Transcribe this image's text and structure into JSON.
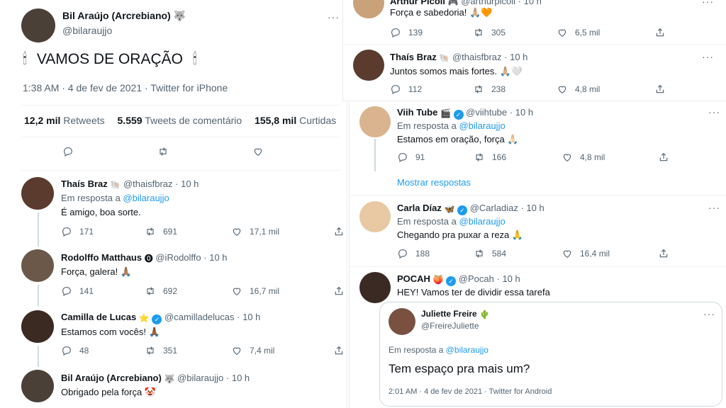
{
  "main_tweet": {
    "name": "Bil Araújo (Arcrebiano)",
    "name_emoji": "🐺",
    "handle": "@bilaraujjo",
    "text": "VAMOS DE ORAÇÃO",
    "lead_emoji": "🕯",
    "trail_emoji": "🕯",
    "timestamp": "1:38 AM · 4 de fev de 2021 · Twitter for iPhone",
    "retweets_count": "12,2 mil",
    "retweets_label": "Retweets",
    "quotes_count": "5.559",
    "quotes_label": "Tweets de comentário",
    "likes_count": "155,8 mil",
    "likes_label": "Curtidas"
  },
  "left_replies": [
    {
      "name": "Thaís Braz",
      "badge": "🐚",
      "handle": "@thaisfbraz",
      "time": "10 h",
      "reply_prefix": "Em resposta a",
      "reply_to": "@bilaraujjo",
      "text": "É amigo, boa sorte.",
      "replies": "171",
      "retweets": "691",
      "likes": "17,1 mil",
      "avatar_color": "#5a3b2e"
    },
    {
      "name": "Rodolffo Matthaus",
      "badge": "⓿",
      "handle": "@iRodolffo",
      "time": "10 h",
      "text": "Força, galera! 🙏🏽",
      "replies": "141",
      "retweets": "692",
      "likes": "16,7 mil",
      "avatar_color": "#6b5848"
    },
    {
      "name": "Camilla de Lucas",
      "badge": "⭐",
      "verified": "✓",
      "handle": "@camilladelucas",
      "time": "10 h",
      "text": "Estamos com vocês! 🙏🏾",
      "replies": "48",
      "retweets": "351",
      "likes": "7,4 mil",
      "avatar_color": "#3a2a22"
    },
    {
      "name": "Bil Araújo (Arcrebiano)",
      "badge": "🐺",
      "handle": "@bilaraujjo",
      "time": "10 h",
      "text": "Obrigado pela força 🤡",
      "avatar_color": "#4a4038"
    }
  ],
  "top_right": [
    {
      "name": "Arthur Picoli",
      "badge": "🎮",
      "handle": "@arthurpicoli",
      "time": "10 h",
      "text": "Força e sabedoria! 🙏🏼🧡",
      "replies": "139",
      "retweets": "305",
      "likes": "6,5 mil",
      "avatar_color": "#c9a27a"
    },
    {
      "name": "Thaís Braz",
      "badge": "🐚",
      "handle": "@thaisfbraz",
      "time": "10 h",
      "text": "Juntos somos mais fortes. 🙏🏼🤍",
      "replies": "112",
      "retweets": "238",
      "likes": "4,8 mil",
      "avatar_color": "#5a3b2e"
    }
  ],
  "bottom_right": [
    {
      "name": "Viih Tube",
      "badge": "🎬",
      "verified": "✓",
      "handle": "@viihtube",
      "time": "10 h",
      "reply_prefix": "Em resposta a",
      "reply_to": "@bilaraujjo",
      "text": "Estamos em oração, força 🙏🏻",
      "replies": "91",
      "retweets": "166",
      "likes": "4,8 mil",
      "show_replies": "Mostrar respostas",
      "avatar_color": "#d9b48f"
    },
    {
      "name": "Carla Díaz",
      "badge": "🦋",
      "verified": "✓",
      "handle": "@Carladiaz",
      "time": "10 h",
      "reply_prefix": "Em resposta a",
      "reply_to": "@bilaraujjo",
      "text": "Chegando pra puxar a reza 🙏",
      "replies": "188",
      "retweets": "584",
      "likes": "16,4 mil",
      "avatar_color": "#e8c9a4"
    },
    {
      "name": "POCAH",
      "badge": "🍑",
      "verified": "✓",
      "handle": "@Pocah",
      "time": "10 h",
      "text": "HEY! Vamos ter de dividir essa tarefa",
      "avatar_color": "#3b2a24"
    }
  ],
  "quoted": {
    "name": "Juliette Freire",
    "badge": "🌵",
    "handle": "@FreireJuliette",
    "reply_prefix": "Em resposta a",
    "reply_to": "@bilaraujjo",
    "text": "Tem espaço pra mais um?",
    "timestamp": "2:01 AM · 4 de fev de 2021 · Twitter for Android",
    "avatar_color": "#7a5040"
  },
  "colors": {
    "accent": "#1d9bf0",
    "secondary_text": "#536471",
    "divider": "#eff3f4"
  }
}
